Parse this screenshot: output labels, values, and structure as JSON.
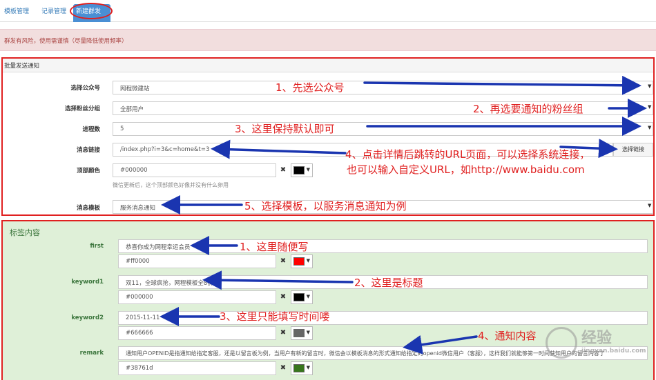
{
  "tabs": [
    "模板管理",
    "记录管理",
    "新建群发"
  ],
  "alert": "群发有风险，使用需谨慎（尽量降低使用频率）",
  "batch": {
    "title": "批量发送通知",
    "account_label": "选择公众号",
    "account_value": "网程微建站",
    "group_label": "选择粉丝分组",
    "group_value": "全部用户",
    "process_label": "进程数",
    "process_value": "5",
    "link_label": "消息链接",
    "link_value": "/index.php?i=3&c=home&t=3",
    "link_button": "选择链接",
    "topcolor_label": "顶部颜色",
    "topcolor_value": "#000000",
    "topcolor_help": "微信更新后，这个顶部颜色好像并没有什么卵用",
    "template_label": "消息模板",
    "template_value": "服务消息通知"
  },
  "tags": {
    "title": "标签内容",
    "clear_glyph": "✖",
    "rows": [
      {
        "label": "first",
        "value": "恭喜你成为网程幸运会员",
        "color": "#ff0000"
      },
      {
        "label": "keyword1",
        "value": "双11，全球疯抢，网程模板全8折",
        "color": "#000000"
      },
      {
        "label": "keyword2",
        "value": "2015-11-11",
        "color": "#666666"
      },
      {
        "label": "remark",
        "value": "通知用户OPENID是指通知给指定客服，还是以留言板为例，当用户有新的留言时，微信会以模板消息的形式通知给指定的openid微信用户（客服），这样我们就能够第一时间获知用户的留言内容了",
        "color": "#38761d"
      }
    ]
  },
  "annotations": {
    "a1": "1、先选公众号",
    "a2": "2、再选要通知的粉丝组",
    "a3": "3、这里保持默认即可",
    "a4_line1": "4、点击详情后跳转的URL页面，可以选择系统连接，",
    "a4_line2": "也可以输入自定义URL，如http://www.baidu.com",
    "a5": "5、选择模板，以服务消息通知为例",
    "b1": "1、这里随便写",
    "b2": "2、这里是标题",
    "b3": "3、这里只能填写时间喽",
    "b4": "4、通知内容"
  },
  "watermark": {
    "text": "经验",
    "url": "jingyan.baidu.com"
  },
  "colors": {
    "accent": "#4a8fd4",
    "annotation": "#e02020",
    "arrow": "#1a35b0",
    "alert_bg": "#f2dede",
    "tags_bg": "#dff0d8"
  }
}
